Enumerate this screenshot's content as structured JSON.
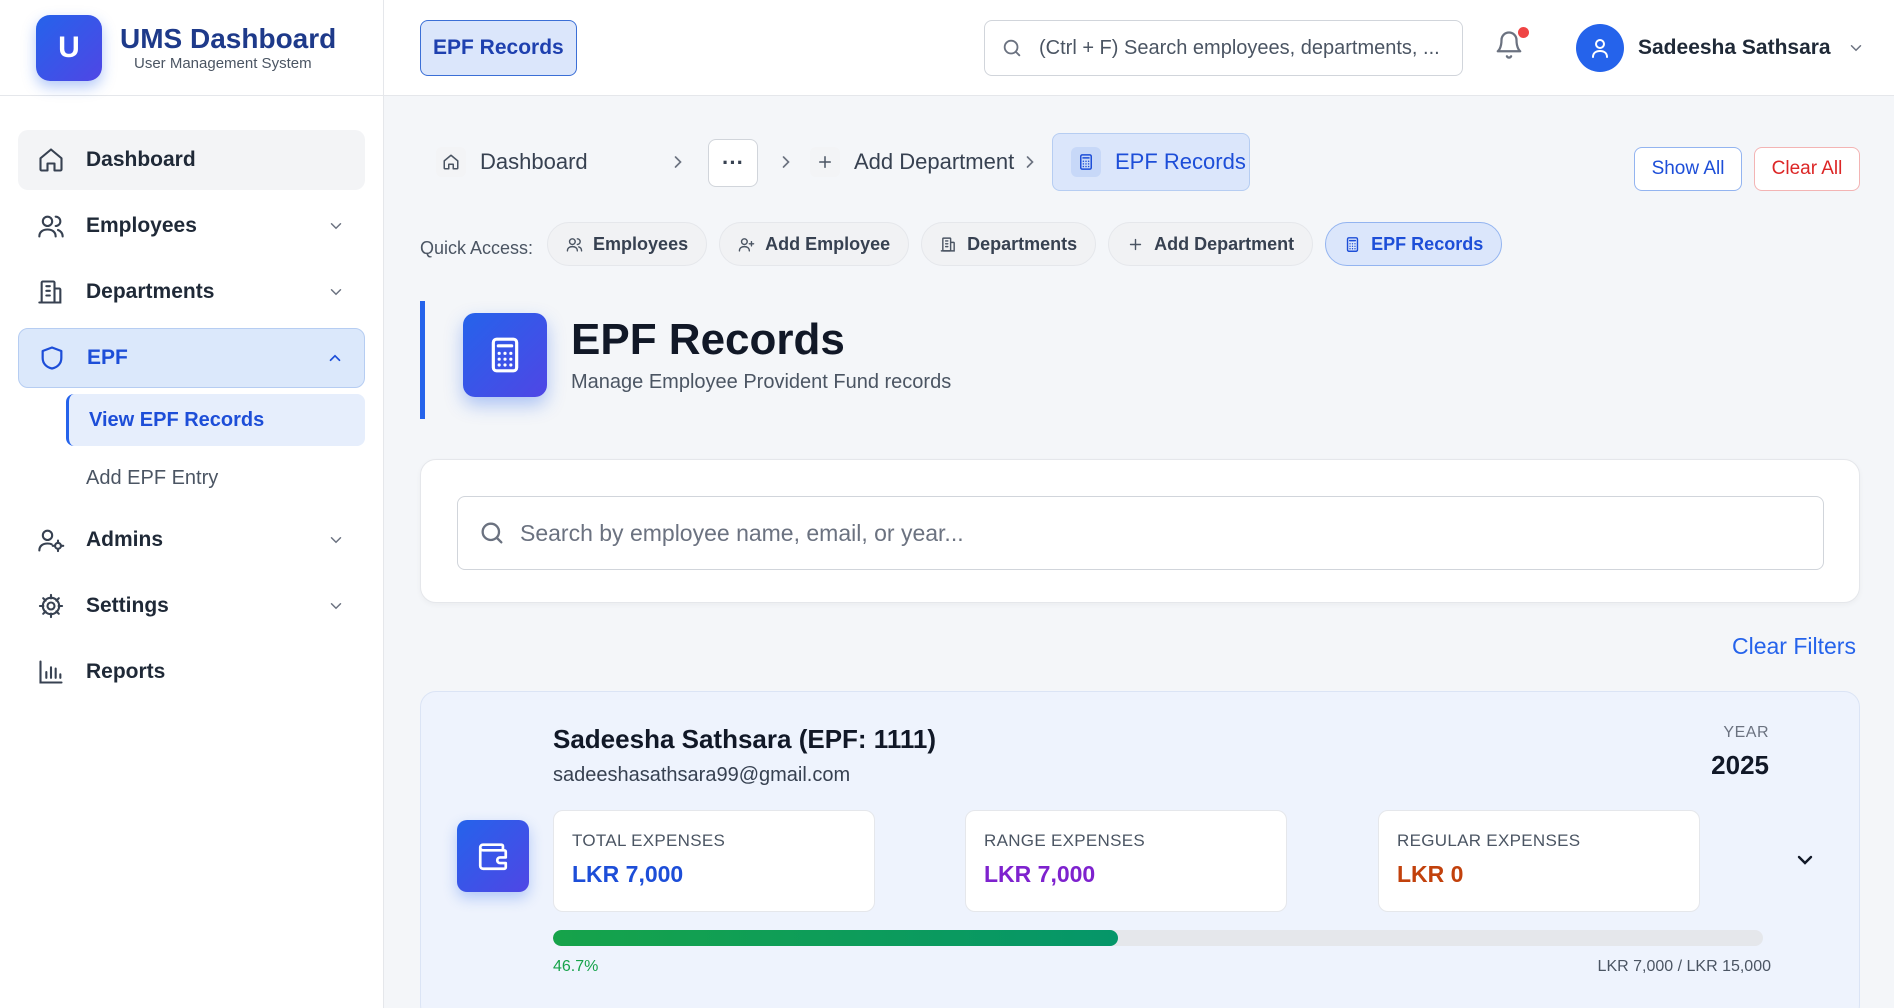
{
  "brand": {
    "logo_letter": "U",
    "title": "UMS Dashboard",
    "subtitle": "User Management System"
  },
  "sidebar": {
    "items": [
      {
        "label": "Dashboard",
        "icon": "home-icon"
      },
      {
        "label": "Employees",
        "icon": "users-icon"
      },
      {
        "label": "Departments",
        "icon": "building-icon"
      },
      {
        "label": "EPF",
        "icon": "shield-icon"
      },
      {
        "label": "Admins",
        "icon": "user-cog-icon"
      },
      {
        "label": "Settings",
        "icon": "gear-icon"
      },
      {
        "label": "Reports",
        "icon": "bar-chart-icon"
      }
    ],
    "epf_sub": [
      "View EPF Records",
      "Add EPF Entry"
    ]
  },
  "header": {
    "current_page": "EPF Records",
    "search_placeholder": "(Ctrl + F) Search employees, departments, ...",
    "user_name": "Sadeesha Sathsara",
    "notification_dot": true
  },
  "breadcrumb": {
    "items": [
      "Dashboard",
      "Add Department",
      "EPF Records"
    ],
    "more": "···",
    "show_all": "Show All",
    "clear_all": "Clear All"
  },
  "quick_access": {
    "label": "Quick Access:",
    "chips": [
      "Employees",
      "Add Employee",
      "Departments",
      "Add Department",
      "EPF Records"
    ]
  },
  "page": {
    "title": "EPF Records",
    "subtitle": "Manage Employee Provident Fund records"
  },
  "search": {
    "placeholder": "Search by employee name, email, or year..."
  },
  "clear_filters": "Clear Filters",
  "record": {
    "name": "Sadeesha Sathsara (EPF: 1111)",
    "email": "sadeeshasathsara99@gmail.com",
    "year_label": "YEAR",
    "year": "2025",
    "stats": [
      {
        "label": "TOTAL EXPENSES",
        "value": "LKR 7,000",
        "color": "#1d4ed8"
      },
      {
        "label": "RANGE EXPENSES",
        "value": "LKR 7,000",
        "color": "#7e22ce"
      },
      {
        "label": "REGULAR EXPENSES",
        "value": "LKR 0",
        "color": "#c2410c"
      }
    ],
    "progress_pct_text": "46.7%",
    "progress_fraction": 0.467,
    "progress_amount": "LKR 7,000 / LKR 15,000"
  },
  "colors": {
    "accent": "#2563eb",
    "brand_dark": "#1e3a8a",
    "danger": "#dc2626",
    "success": "#16a34a"
  }
}
